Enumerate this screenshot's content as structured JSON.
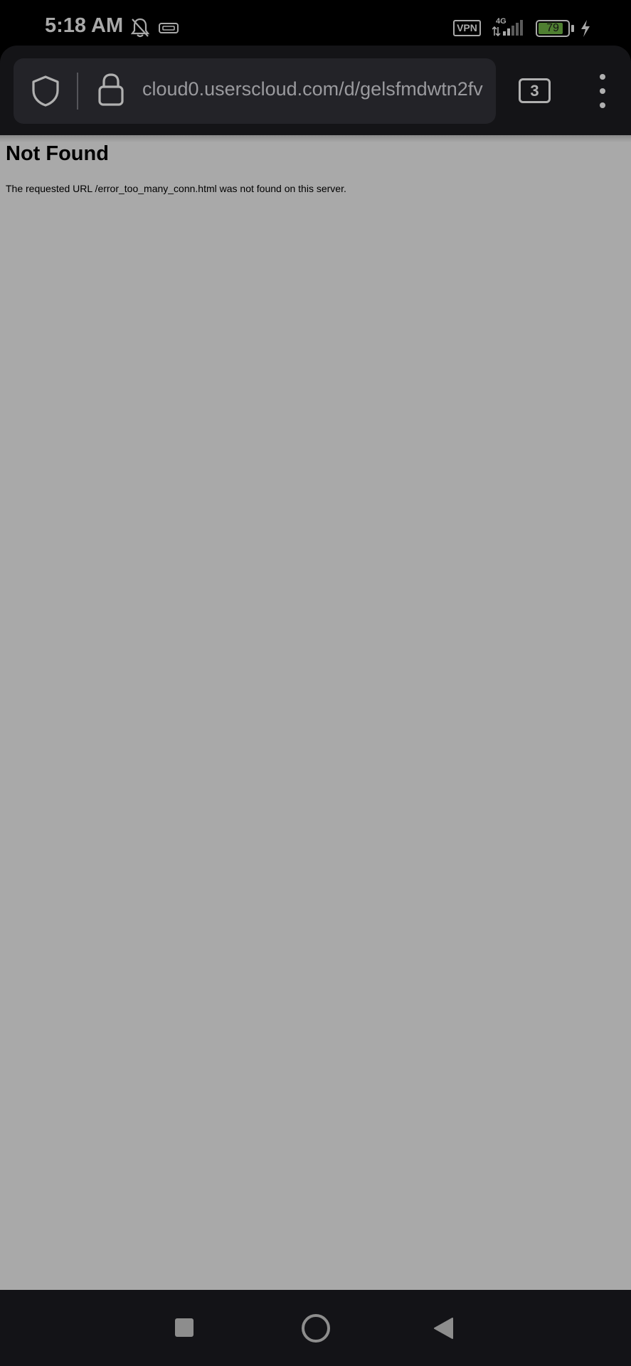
{
  "status_bar": {
    "time": "5:18 AM",
    "vpn_label": "VPN",
    "network_label": "4G",
    "battery_level": "79",
    "icons": [
      "bell-off-icon",
      "hdmi-icon",
      "signal-icon",
      "battery-icon",
      "charging-icon"
    ],
    "battery_color": "#4f7f31"
  },
  "browser": {
    "url": "cloud0.userscloud.com/d/gelsfmdwtn2fv",
    "tab_count": "3",
    "icons": [
      "shield-icon",
      "lock-icon",
      "more-vert-icon"
    ]
  },
  "page": {
    "heading": "Not Found",
    "message": "The requested URL /error_too_many_conn.html was not found on this server.",
    "background_color": "#a9a9a9"
  },
  "nav_bar": {
    "icons": [
      "recents-icon",
      "home-icon",
      "back-icon"
    ]
  }
}
